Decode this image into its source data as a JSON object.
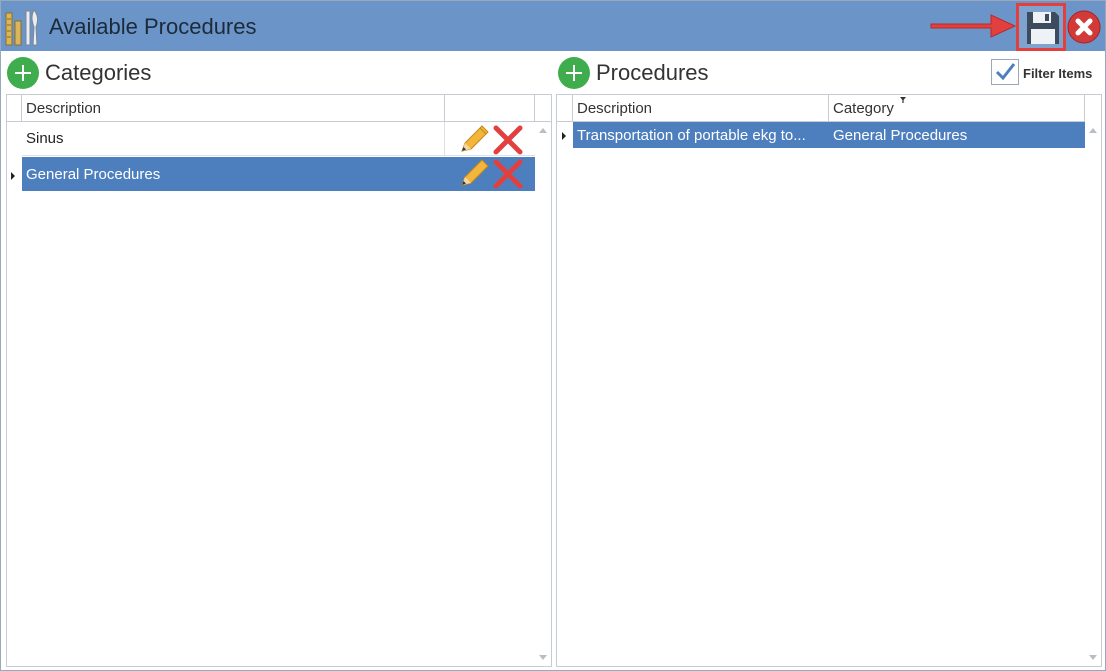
{
  "window": {
    "title": "Available Procedures",
    "icons": {
      "app": "medical-instruments-icon",
      "save": "floppy-disk-icon",
      "close": "close-circle-icon",
      "arrow": "red-arrow-pointer-icon"
    }
  },
  "categories": {
    "title": "Categories",
    "columns": [
      "Description"
    ],
    "rows": [
      {
        "description": "Sinus",
        "selected": false
      },
      {
        "description": "General Procedures",
        "selected": true
      }
    ],
    "row_icons": {
      "edit": "pencil-icon",
      "delete": "red-x-icon"
    }
  },
  "procedures": {
    "title": "Procedures",
    "filter_label": "Filter Items",
    "filter_checked": true,
    "columns": [
      "Description",
      "Category"
    ],
    "rows": [
      {
        "description": "Transportation of portable ekg to...",
        "category": "General Procedures",
        "selected": true
      }
    ]
  },
  "colors": {
    "titlebar": "#6b95c9",
    "selected_row": "#4d7fbf",
    "add_button": "#3fad4e",
    "highlight_border": "#e2403f"
  }
}
